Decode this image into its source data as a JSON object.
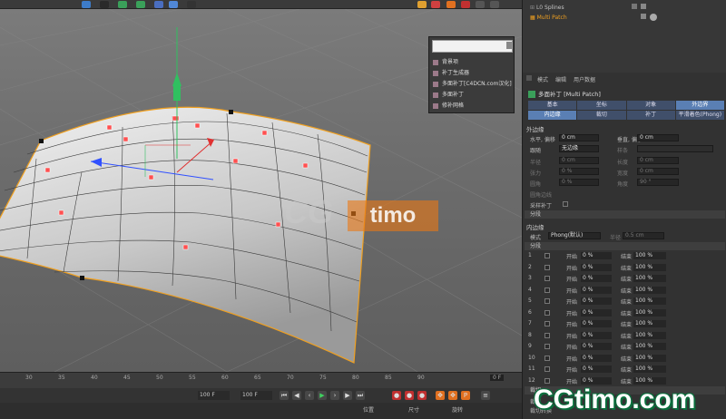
{
  "popup": {
    "items": [
      "背景项",
      "补丁生成器",
      "多面补丁[C4DCN.com汉化]",
      "多面补丁",
      "修补网格"
    ]
  },
  "watermark": {
    "cg": "CG",
    "timo": "timo"
  },
  "timeline": {
    "ticks": [
      "30",
      "35",
      "40",
      "45",
      "50",
      "55",
      "60",
      "65",
      "70",
      "75",
      "80",
      "85",
      "90"
    ],
    "frame_label": "0 F",
    "start_frame": "100 F",
    "end_frame": "100 F"
  },
  "bottom_bar": {
    "position": "位置",
    "size": "尺寸",
    "rotation": "旋转"
  },
  "object_manager": {
    "splines": "Splines",
    "multi_patch": "Multi Patch"
  },
  "attributes": {
    "menu": [
      "模式",
      "编辑",
      "用户数据"
    ],
    "title": "多面补丁 [Multi Patch]",
    "tabs_row1": [
      "基本",
      "坐标",
      "对象",
      "外边界"
    ],
    "tabs_row2": [
      "内边缘",
      "裁切",
      "补丁",
      "平滑着色(Phong)"
    ],
    "sec_outer": "外边缘",
    "h_offset_label": "水平, 偏移",
    "h_offset_value": "0 cm",
    "v_offset_label": "垂直, 偏移",
    "v_offset_value": "0 cm",
    "follow_label": "跟随",
    "follow_value": "无边缘",
    "spline_label": "样条",
    "half_label": "半径",
    "half_value": "0 cm",
    "length_label": "长度",
    "length_value": "0 cm",
    "tension_label": "张力",
    "tension_value": "0 %",
    "width_label": "宽度",
    "width_value": "0 cm",
    "round_label": "圆角",
    "round_value": "0 %",
    "angle_label": "角度",
    "angle_value": "90 °",
    "reverse_label": "圆角边线",
    "sample_label": "采样补丁",
    "split_bar": "分段",
    "sec_inner": "内边缘",
    "mode_label": "模式",
    "mode_value": "Phong(默认)",
    "radius_label": "半径",
    "radius_value": "0.5 cm",
    "divide_bar": "分段",
    "start_label": "开始",
    "end_label": "结束",
    "rows": [
      {
        "n": "1",
        "start": "0 %",
        "end": "100 %"
      },
      {
        "n": "2",
        "start": "0 %",
        "end": "100 %"
      },
      {
        "n": "3",
        "start": "0 %",
        "end": "100 %"
      },
      {
        "n": "4",
        "start": "0 %",
        "end": "100 %"
      },
      {
        "n": "5",
        "start": "0 %",
        "end": "100 %"
      },
      {
        "n": "6",
        "start": "0 %",
        "end": "100 %"
      },
      {
        "n": "7",
        "start": "0 %",
        "end": "100 %"
      },
      {
        "n": "8",
        "start": "0 %",
        "end": "100 %"
      },
      {
        "n": "9",
        "start": "0 %",
        "end": "100 %"
      },
      {
        "n": "10",
        "start": "0 %",
        "end": "100 %"
      },
      {
        "n": "11",
        "start": "0 %",
        "end": "100 %"
      },
      {
        "n": "12",
        "start": "0 %",
        "end": "100 %"
      }
    ],
    "bottom_sec": "裁切",
    "bottom_sub": "裁切",
    "bottom_sub2": "裁切转换"
  },
  "brand": "CGtimo.com",
  "colors": {
    "accent": "#f0a020",
    "tab": "#404f6a",
    "tab_active": "#5a7fb4"
  }
}
